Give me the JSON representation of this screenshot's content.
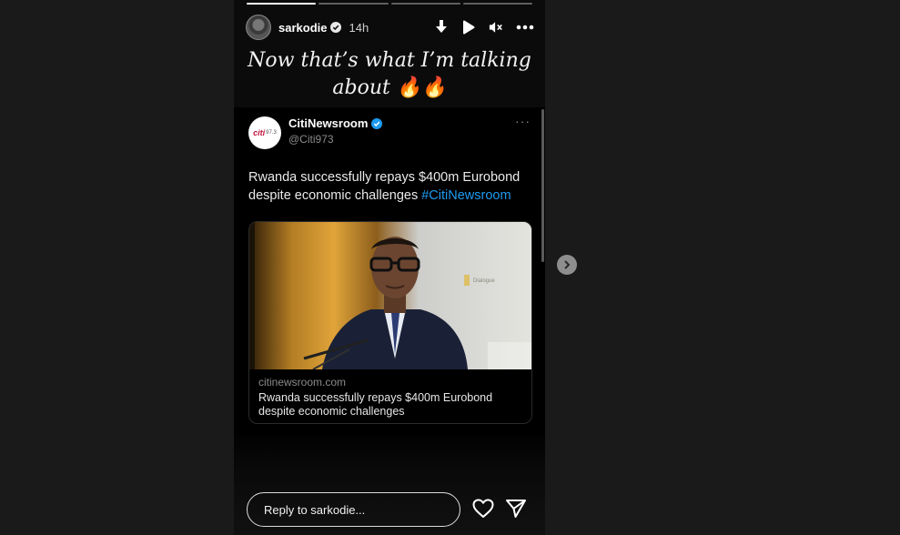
{
  "story": {
    "username": "sarkodie",
    "time_ago": "14h",
    "caption_line1": "Now that’s what I’m talking",
    "caption_line2": "about 🔥🔥",
    "progress_segments": 4,
    "progress_active_index": 0,
    "header_icons": [
      "download-icon",
      "play-icon",
      "mute-icon",
      "more-icon"
    ]
  },
  "tweet": {
    "name": "CitiNewsroom",
    "handle": "@Citi973",
    "text": "Rwanda successfully repays $400m Eurobond despite economic challenges ",
    "hashtag": "#CitiNewsroom",
    "logo_text": "citi",
    "logo_sub": "97.3",
    "card": {
      "domain": "citinewsroom.com",
      "title": "Rwanda successfully repays $400m Eurobond despite economic challenges"
    }
  },
  "reply": {
    "placeholder": "Reply to sarkodie..."
  },
  "colors": {
    "accent_link": "#1d9bf0",
    "verified": "#1d9bf0",
    "page_bg": "#1a1a1a"
  }
}
